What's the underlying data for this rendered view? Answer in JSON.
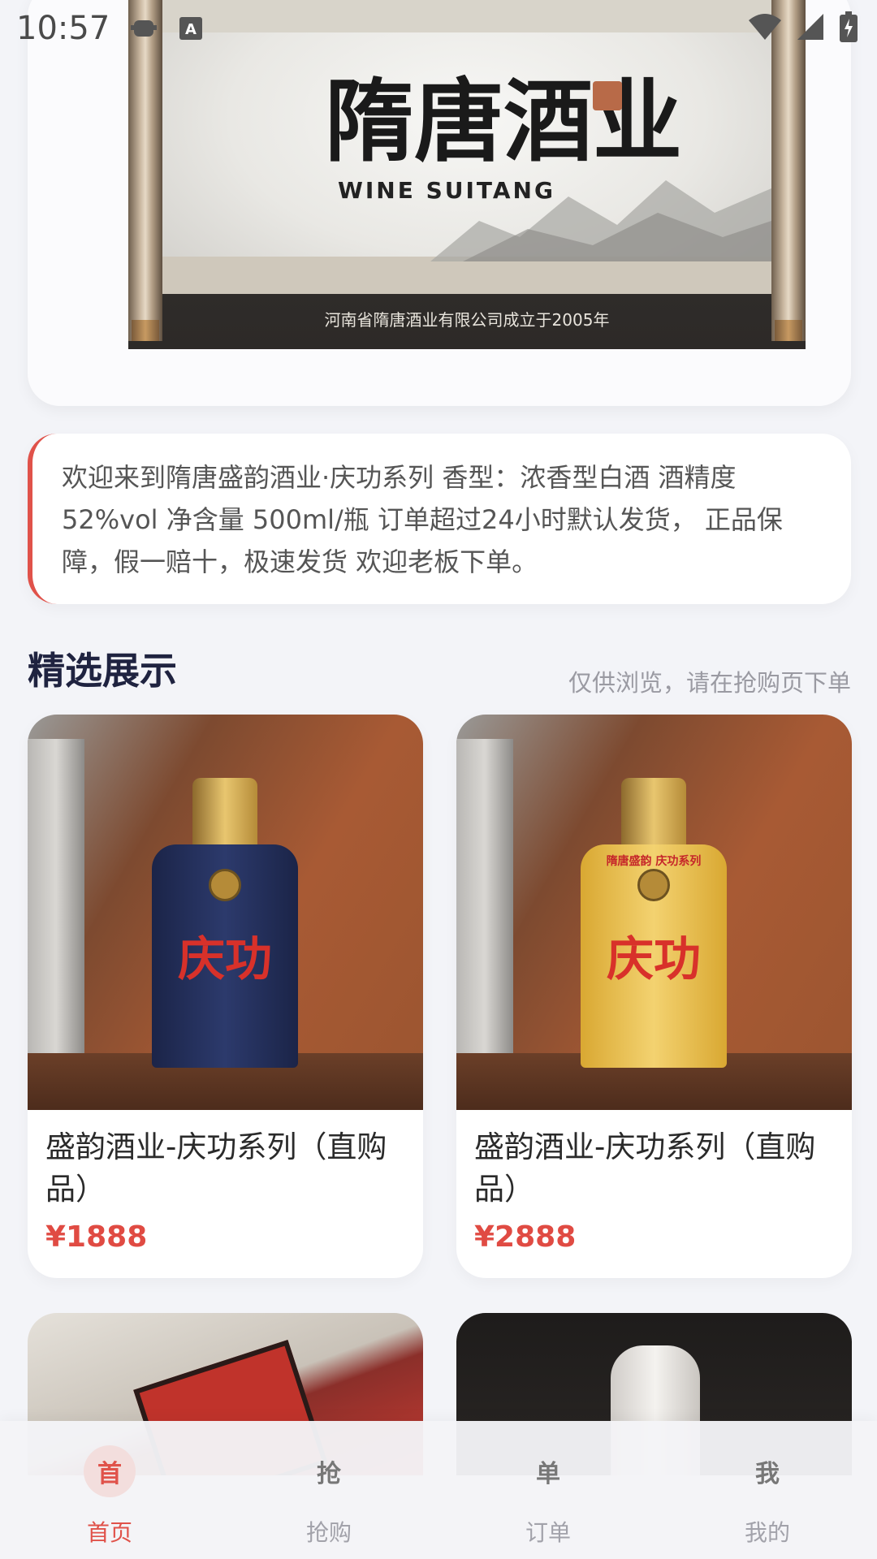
{
  "status_bar": {
    "time": "10:57",
    "icons": [
      "notification-icon",
      "keyboard-a-icon",
      "wifi-icon",
      "signal-icon",
      "battery-icon"
    ],
    "keyboard_glyph": "A"
  },
  "banner": {
    "title": "隋唐酒业",
    "subtitle": "WINE SUITANG",
    "caption": "河南省隋唐酒业有限公司成立于2005年"
  },
  "notice": {
    "text": "欢迎来到隋唐盛韵酒业·庆功系列 香型：浓香型白酒 酒精度52%vol 净含量 500ml/瓶 订单超过24小时默认发货， 正品保障，假一赔十，极速发货 欢迎老板下单。",
    "accent_color": "#e0524a"
  },
  "section": {
    "title": "精选展示",
    "hint": "仅供浏览，请在抢购页下单"
  },
  "products": [
    {
      "name": "盛韵酒业-庆功系列（直购品）",
      "price": "¥1888",
      "bottle_label": "庆功",
      "bottle_color": "navy"
    },
    {
      "name": "盛韵酒业-庆功系列（直购品）",
      "price": "¥2888",
      "bottle_label": "庆功",
      "bottle_band": "隋唐盛韵  庆功系列",
      "bottle_color": "gold"
    }
  ],
  "tabs": [
    {
      "icon_text": "首",
      "label": "首页",
      "active": true
    },
    {
      "icon_text": "抢",
      "label": "抢购",
      "active": false
    },
    {
      "icon_text": "单",
      "label": "订单",
      "active": false
    },
    {
      "icon_text": "我",
      "label": "我的",
      "active": false
    }
  ],
  "colors": {
    "accent": "#e0524a",
    "price": "#e04b43",
    "background": "#f3f4f8",
    "section_title": "#1f2340"
  }
}
